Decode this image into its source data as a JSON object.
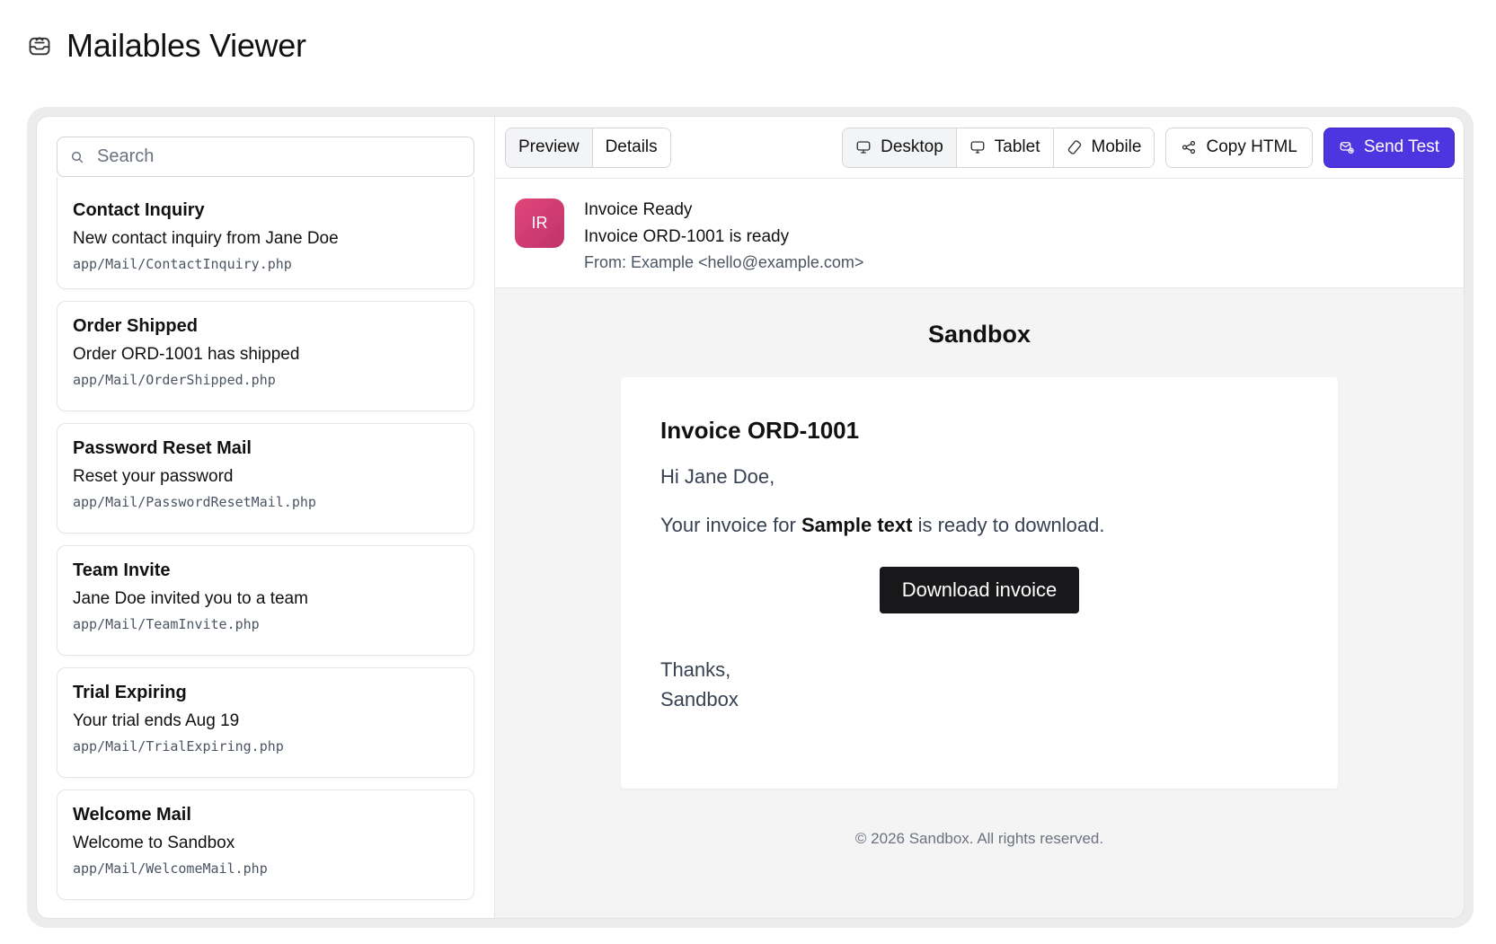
{
  "app": {
    "title": "Mailables Viewer",
    "icon": "mail-tray-icon"
  },
  "sidebar": {
    "search_placeholder": "Search",
    "items": [
      {
        "name": "Contact Inquiry",
        "subject": "New contact inquiry from Jane Doe",
        "path": "app/Mail/ContactInquiry.php"
      },
      {
        "name": "Order Shipped",
        "subject": "Order ORD-1001 has shipped",
        "path": "app/Mail/OrderShipped.php"
      },
      {
        "name": "Password Reset Mail",
        "subject": "Reset your password",
        "path": "app/Mail/PasswordResetMail.php"
      },
      {
        "name": "Team Invite",
        "subject": "Jane Doe invited you to a team",
        "path": "app/Mail/TeamInvite.php"
      },
      {
        "name": "Trial Expiring",
        "subject": "Your trial ends Aug 19",
        "path": "app/Mail/TrialExpiring.php"
      },
      {
        "name": "Welcome Mail",
        "subject": "Welcome to Sandbox",
        "path": "app/Mail/WelcomeMail.php"
      }
    ]
  },
  "toolbar": {
    "tabs": [
      "Preview",
      "Details"
    ],
    "active_tab": "Preview",
    "devices": [
      "Desktop",
      "Tablet",
      "Mobile"
    ],
    "active_device": "Desktop",
    "copy_html": "Copy HTML",
    "send_test": "Send Test",
    "accent_color": "#4f35e0"
  },
  "meta": {
    "avatar": "IR",
    "name": "Invoice Ready",
    "subject": "Invoice ORD-1001 is ready",
    "from": "From: Example <hello@example.com>"
  },
  "email": {
    "brand": "Sandbox",
    "heading": "Invoice ORD-1001",
    "greeting": "Hi Jane Doe,",
    "body_before": "Your invoice for ",
    "body_bold": "Sample text",
    "body_after": " is ready to download.",
    "cta": "Download invoice",
    "signoff_1": "Thanks,",
    "signoff_2": "Sandbox",
    "footer": "© 2026 Sandbox. All rights reserved."
  }
}
